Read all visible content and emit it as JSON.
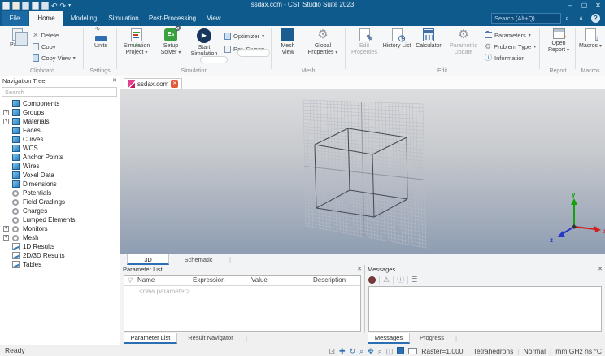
{
  "colors": {
    "titlebar": "#0E5A8C",
    "accent": "#2A6FB5",
    "tab_close": "#E2593B",
    "canvas_top": "#DCDDDF",
    "canvas_bottom": "#8E9DB2",
    "axis_x": "#CF2121",
    "axis_y": "#13A10E",
    "axis_z": "#2438C9"
  },
  "icons": {
    "undo": "↶",
    "redo": "↷",
    "dropdown": "▾",
    "search": "⌕",
    "minimize": "–",
    "maximize": "▢",
    "close": "✕",
    "warning": "⚠",
    "info": "ⓘ",
    "filter": "▽",
    "caret_up": "∧",
    "help": "?",
    "list": "≣",
    "play": "▶",
    "delete": "✕",
    "pencil": "✎",
    "gear": "⚙",
    "pie": "◔",
    "down_arrow": "↓",
    "clock": "◷",
    "select": "⊡",
    "move": "✚",
    "rotate": "↻",
    "magnifier": "⌕",
    "pan": "✥",
    "split": "◫",
    "wave": "∿",
    "solver_label": "Es"
  },
  "titlebar": {
    "title": "ssdax.com - CST Studio Suite 2023"
  },
  "menu": {
    "tabs": [
      "File",
      "Home",
      "Modeling",
      "Simulation",
      "Post-Processing",
      "View"
    ],
    "active_tab": "Home",
    "search_placeholder": "Search (Alt+Q)"
  },
  "ribbon": {
    "clipboard": {
      "group": "Clipboard",
      "paste": "Paste",
      "delete": "Delete",
      "copy": "Copy",
      "copy_view": "Copy View"
    },
    "settings": {
      "group": "Settings",
      "units": "Units"
    },
    "simulation": {
      "group": "Simulation",
      "simulation_project": "Simulation Project",
      "setup_solver": "Setup Solver",
      "start_simulation": "Start Simulation",
      "optimizer": "Optimizer",
      "par_sweep": "Par. Sweep"
    },
    "mesh": {
      "group": "Mesh",
      "mesh_view": "Mesh View",
      "global_properties": "Global Properties"
    },
    "edit": {
      "group": "Edit",
      "edit_properties": "Edit Properties",
      "history_list": "History List",
      "calculator": "Calculator",
      "parametric_update": "Parametric Update",
      "parameters": "Parameters",
      "problem_type": "Problem Type",
      "information": "Information"
    },
    "report": {
      "group": "Report",
      "open_report": "Open Report"
    },
    "macros": {
      "group": "Macros",
      "macros": "Macros"
    }
  },
  "nav_tree": {
    "title": "Navigation Tree",
    "search_placeholder": "Search",
    "items": [
      {
        "label": "Components"
      },
      {
        "label": "Groups"
      },
      {
        "label": "Materials"
      },
      {
        "label": "Faces"
      },
      {
        "label": "Curves"
      },
      {
        "label": "WCS"
      },
      {
        "label": "Anchor Points"
      },
      {
        "label": "Wires"
      },
      {
        "label": "Voxel Data"
      },
      {
        "label": "Dimensions"
      },
      {
        "label": "Potentials"
      },
      {
        "label": "Field Gradings"
      },
      {
        "label": "Charges"
      },
      {
        "label": "Lumped Elements"
      },
      {
        "label": "Monitors"
      },
      {
        "label": "Mesh"
      },
      {
        "label": "1D Results"
      },
      {
        "label": "2D/3D Results"
      },
      {
        "label": "Tables"
      }
    ]
  },
  "document_tab": {
    "label": "ssdax.com"
  },
  "canvas": {
    "axes": {
      "x": "x",
      "y": "y",
      "z": "z"
    }
  },
  "view_tabs": {
    "t3d": "3D",
    "schematic": "Schematic"
  },
  "parameter_list": {
    "title": "Parameter List",
    "columns": [
      "Name",
      "Expression",
      "Value",
      "Description"
    ],
    "placeholder_row": "<new parameter>",
    "tab_parameter_list": "Parameter List",
    "tab_result_navigator": "Result Navigator"
  },
  "messages": {
    "title": "Messages",
    "tab_messages": "Messages",
    "tab_progress": "Progress"
  },
  "status": {
    "ready": "Ready",
    "raster": "Raster=1.000",
    "mesh_type": "Tetrahedrons",
    "view_mode": "Normal",
    "units": "mm GHz ns °C"
  }
}
